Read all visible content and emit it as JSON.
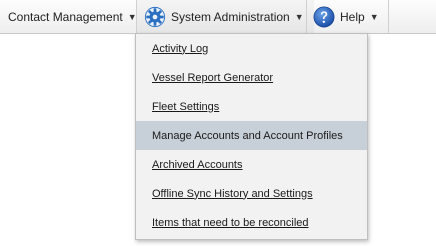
{
  "navbar": {
    "contact_management": "Contact Management",
    "system_administration": "System Administration",
    "help": "Help",
    "caret": "▼"
  },
  "icons": {
    "system_administration": "gear-icon",
    "help": "help-question-icon",
    "gear_color": "#2a6fc0",
    "help_color": "#1f5fbf"
  },
  "dropdown": {
    "items": [
      {
        "label": "Activity Log"
      },
      {
        "label": "Vessel Report Generator"
      },
      {
        "label": "Fleet Settings"
      },
      {
        "label": "Manage Accounts and Account Profiles"
      },
      {
        "label": "Archived Accounts"
      },
      {
        "label": "Offline Sync History and Settings"
      },
      {
        "label": "Items that need to be reconciled"
      }
    ],
    "highlighted_label": "Manage Accounts and Account Profiles",
    "highlight_color": "#c7cfd9"
  }
}
